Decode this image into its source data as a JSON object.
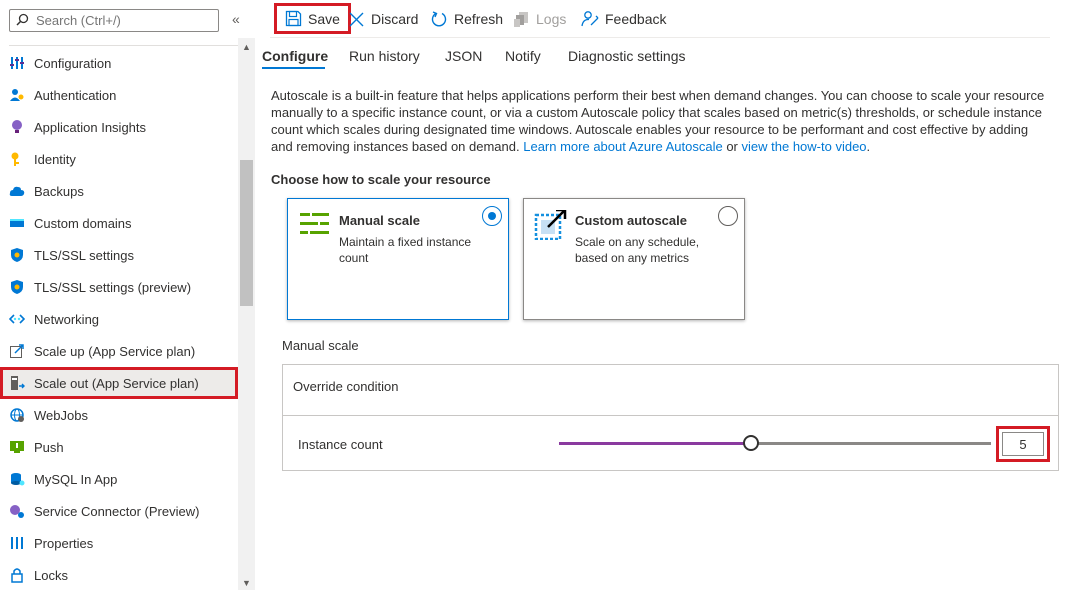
{
  "sidebar": {
    "search_placeholder": "Search (Ctrl+/)",
    "collapse_glyph": "«",
    "items": [
      {
        "label": "Configuration",
        "icon": "configuration-icon"
      },
      {
        "label": "Authentication",
        "icon": "authentication-icon"
      },
      {
        "label": "Application Insights",
        "icon": "application-insights-icon"
      },
      {
        "label": "Identity",
        "icon": "identity-icon"
      },
      {
        "label": "Backups",
        "icon": "backups-icon"
      },
      {
        "label": "Custom domains",
        "icon": "custom-domains-icon"
      },
      {
        "label": "TLS/SSL settings",
        "icon": "shield-icon"
      },
      {
        "label": "TLS/SSL settings (preview)",
        "icon": "shield-icon"
      },
      {
        "label": "Networking",
        "icon": "networking-icon"
      },
      {
        "label": "Scale up (App Service plan)",
        "icon": "scale-up-icon"
      },
      {
        "label": "Scale out (App Service plan)",
        "icon": "scale-out-icon",
        "selected": true
      },
      {
        "label": "WebJobs",
        "icon": "webjobs-icon"
      },
      {
        "label": "Push",
        "icon": "push-icon"
      },
      {
        "label": "MySQL In App",
        "icon": "mysql-icon"
      },
      {
        "label": "Service Connector (Preview)",
        "icon": "service-connector-icon"
      },
      {
        "label": "Properties",
        "icon": "properties-icon"
      },
      {
        "label": "Locks",
        "icon": "lock-icon"
      }
    ]
  },
  "toolbar": {
    "save_label": "Save",
    "discard_label": "Discard",
    "refresh_label": "Refresh",
    "logs_label": "Logs",
    "feedback_label": "Feedback"
  },
  "tabs": [
    "Configure",
    "Run history",
    "JSON",
    "Notify",
    "Diagnostic settings"
  ],
  "description": {
    "text": "Autoscale is a built-in feature that helps applications perform their best when demand changes. You can choose to scale your resource manually to a specific instance count, or via a custom Autoscale policy that scales based on metric(s) thresholds, or schedule instance count which scales during designated time windows. Autoscale enables your resource to be performant and cost effective by adding and removing instances based on demand.",
    "link1": "Learn more about Azure Autoscale",
    "connector": "or",
    "link2": "view the how-to video",
    "end": "."
  },
  "scale_choice": {
    "title": "Choose how to scale your resource",
    "manual": {
      "title": "Manual scale",
      "description": "Maintain a fixed instance count",
      "selected": true
    },
    "custom": {
      "title": "Custom autoscale",
      "description": "Scale on any schedule, based on any metrics",
      "selected": false
    }
  },
  "manual_scale": {
    "section_label": "Manual scale",
    "override_label": "Override condition",
    "instance_label": "Instance count",
    "instance_count": "5",
    "slider_fraction": 0.445
  },
  "colors": {
    "accent": "#0078d4",
    "highlight": "#d41b24",
    "slider_fill": "#8a3a9f"
  }
}
